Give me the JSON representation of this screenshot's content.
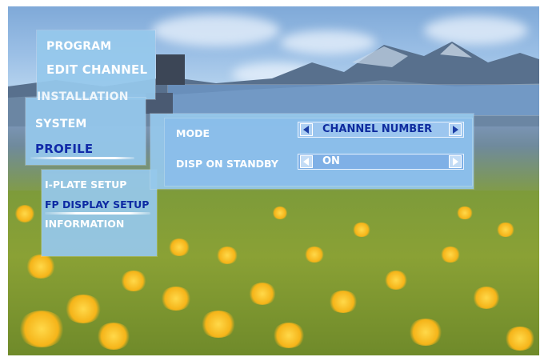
{
  "main_menu": {
    "items": [
      {
        "label": "PROGRAM",
        "active": false
      },
      {
        "label": "EDIT CHANNEL",
        "active": false
      },
      {
        "label": "INSTALLATION",
        "active": false
      },
      {
        "label": "SYSTEM",
        "active": false
      },
      {
        "label": "PROFILE",
        "active": true
      }
    ]
  },
  "submenu": {
    "items": [
      {
        "label": "I-PLATE SETUP",
        "active": false
      },
      {
        "label": "FP DISPLAY SETUP",
        "active": true
      },
      {
        "label": "INFORMATION",
        "active": false
      }
    ]
  },
  "settings": {
    "mode": {
      "label": "MODE",
      "value": "CHANNEL NUMBER"
    },
    "disp_on_standby": {
      "label": "DISP ON STANDBY",
      "value": "ON"
    }
  },
  "colors": {
    "panel": "#96c8ec",
    "active_text": "#102aa8",
    "inactive_text": "#ffffff",
    "selector_bg": "#7fb0e6"
  },
  "icons": [
    "left-arrow-icon",
    "right-arrow-icon"
  ]
}
